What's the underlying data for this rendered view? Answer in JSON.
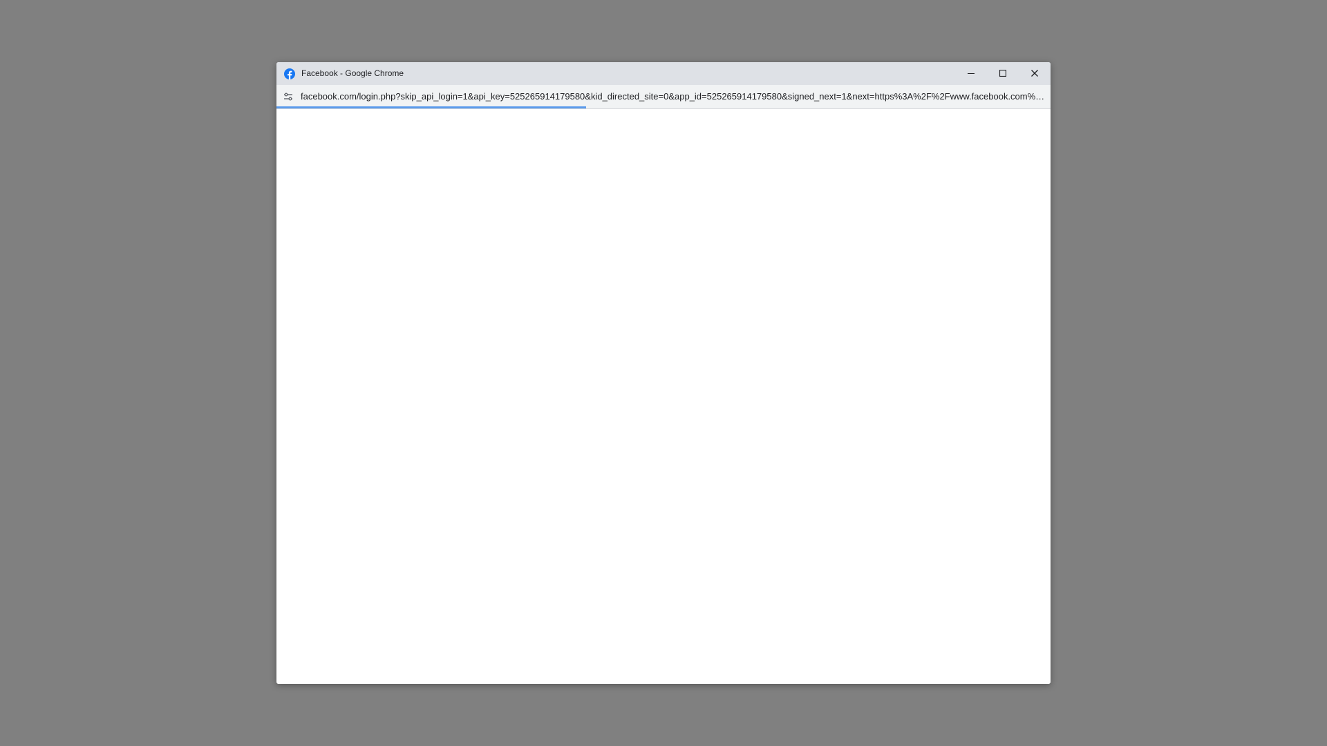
{
  "window": {
    "title": "Facebook - Google Chrome",
    "favicon_icon": "facebook-icon",
    "controls": {
      "minimize_icon": "minimize-icon",
      "maximize_icon": "maximize-icon",
      "close_icon": "close-icon"
    }
  },
  "addressbar": {
    "site_info_icon": "tune-icon",
    "url": "facebook.com/login.php?skip_api_login=1&api_key=525265914179580&kid_directed_site=0&app_id=525265914179580&signed_next=1&next=https%3A%2F%2Fwww.facebook.com%2…"
  },
  "loading": {
    "progress_fraction": 0.4
  },
  "colors": {
    "desktop_bg": "#808080",
    "titlebar_bg": "#dee1e6",
    "facebook_blue": "#1877f2",
    "progress_blue": "#1a73e8"
  }
}
